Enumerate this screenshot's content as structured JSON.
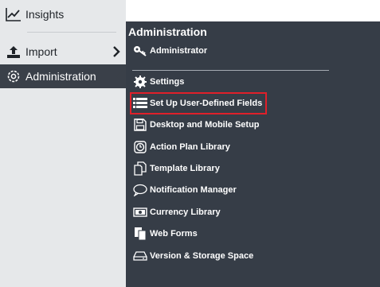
{
  "sidebar": {
    "insights_label": "Insights",
    "import_label": "Import",
    "admin_label": "Administration"
  },
  "panel": {
    "title": "Administration",
    "items": [
      {
        "label": "Administrator",
        "icon": "key-icon"
      },
      {
        "label": "Settings",
        "icon": "gear-icon"
      },
      {
        "label": "Set Up User-Defined Fields",
        "icon": "list-icon",
        "highlighted": true
      },
      {
        "label": "Desktop and Mobile Setup",
        "icon": "floppy-disk-icon"
      },
      {
        "label": "Action Plan Library",
        "icon": "clock-icon"
      },
      {
        "label": "Template Library",
        "icon": "documents-icon"
      },
      {
        "label": "Notification Manager",
        "icon": "speech-bubble-icon"
      },
      {
        "label": "Currency Library",
        "icon": "banknote-icon"
      },
      {
        "label": "Web Forms",
        "icon": "forms-icon"
      },
      {
        "label": "Version & Storage Space",
        "icon": "hard-drive-icon"
      }
    ]
  },
  "colors": {
    "sidebar_bg": "#e6e8ea",
    "panel_bg": "#363d47",
    "active_bg": "#3a4049",
    "highlight_border": "#e0202a"
  }
}
